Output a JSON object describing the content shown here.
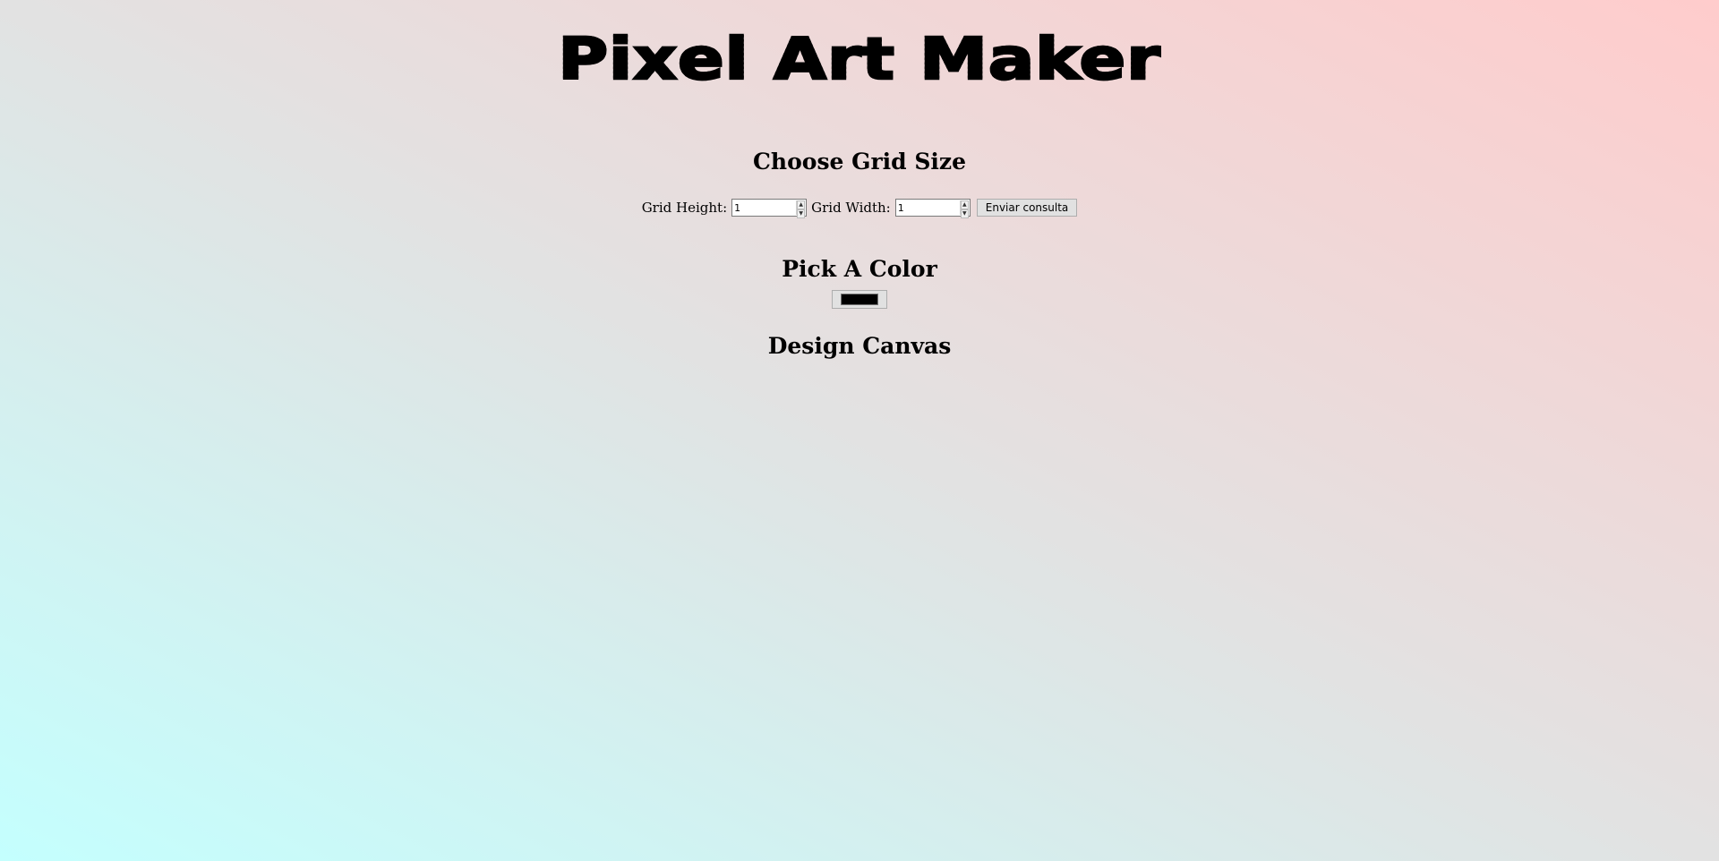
{
  "title": "Pixel Art Maker",
  "sections": {
    "grid_size_heading": "Choose Grid Size",
    "color_heading": "Pick A Color",
    "canvas_heading": "Design Canvas"
  },
  "form": {
    "height_label": "Grid Height:",
    "height_value": "1",
    "width_label": "Grid Width:",
    "width_value": "1",
    "submit_label": "Enviar consulta"
  },
  "color_picker": {
    "value": "#000000"
  },
  "colors": {
    "gradient_start": "#c4fffe",
    "gradient_mid": "#e2e2e2",
    "gradient_end": "#ffcccc"
  }
}
